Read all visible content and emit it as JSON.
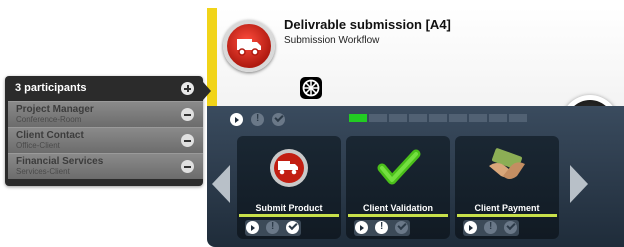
{
  "workflow": {
    "title": "Delivrable submission [A4]",
    "subtitle": "Submission Workflow",
    "icon": "truck-icon",
    "accent_color": "#f1d419"
  },
  "participants": {
    "header": "3 participants",
    "items": [
      {
        "role": "Project Manager",
        "detail": "Conference-Room"
      },
      {
        "role": "Client Contact",
        "detail": "Office-Client"
      },
      {
        "role": "Financial Services",
        "detail": "Services-Client"
      }
    ]
  },
  "progress": {
    "done": 1,
    "total": 9,
    "done_color": "#22cc22"
  },
  "steps": [
    {
      "label": "Submit Product",
      "icon": "truck-icon"
    },
    {
      "label": "Client Validation",
      "icon": "checkmark-icon"
    },
    {
      "label": "Client Payment",
      "icon": "money-handshake-icon"
    }
  ]
}
